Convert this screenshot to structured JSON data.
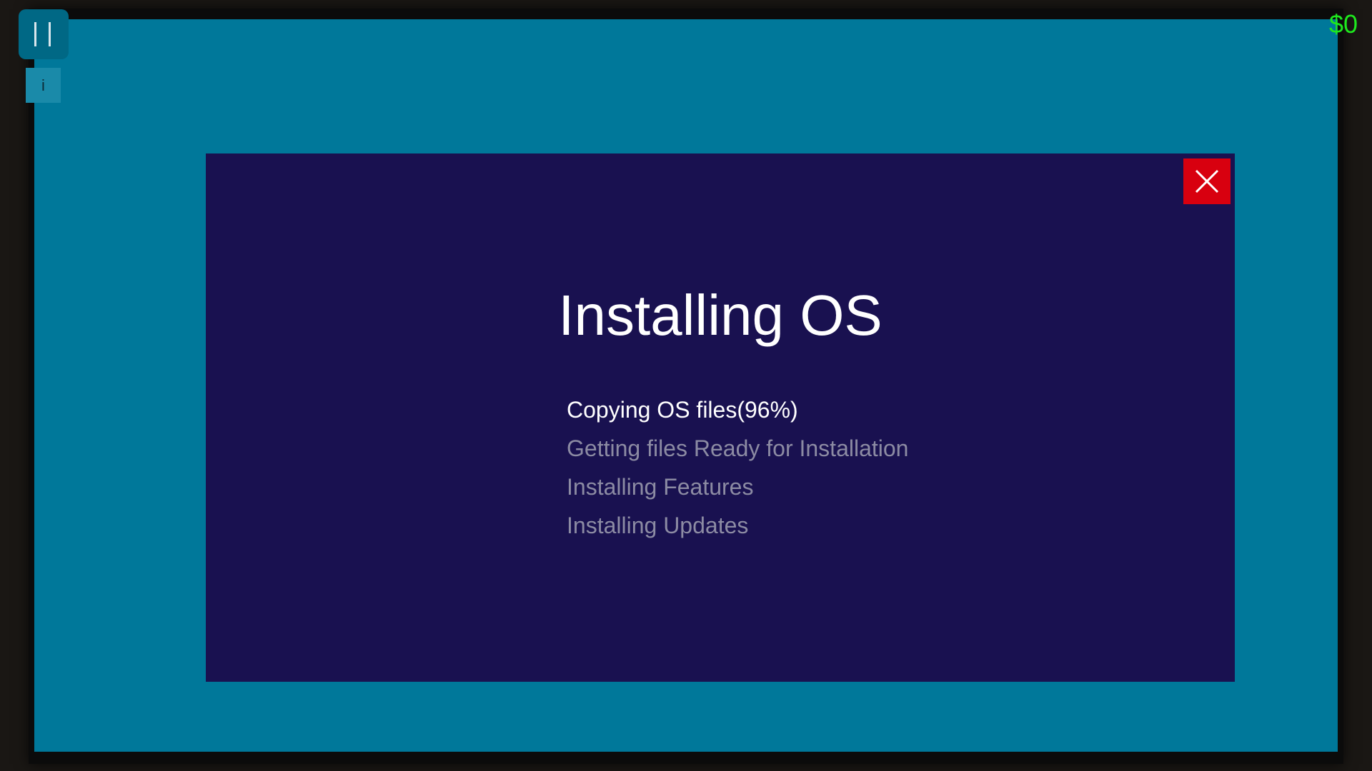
{
  "hud": {
    "money": "$0",
    "info_label": "i"
  },
  "installer": {
    "title": "Installing OS",
    "steps": [
      {
        "label": "Copying OS files(96%)",
        "active": true
      },
      {
        "label": "Getting files Ready for Installation",
        "active": false
      },
      {
        "label": "Installing Features",
        "active": false
      },
      {
        "label": "Installing Updates",
        "active": false
      }
    ]
  },
  "colors": {
    "screen_background": "#00789a",
    "window_background": "#191150",
    "close_button": "#d8000f",
    "money_text": "#1ee81e",
    "inactive_step": "#8c8ba3"
  },
  "icons": {
    "pause": "pause-icon",
    "close": "close-icon",
    "info": "info-icon"
  }
}
